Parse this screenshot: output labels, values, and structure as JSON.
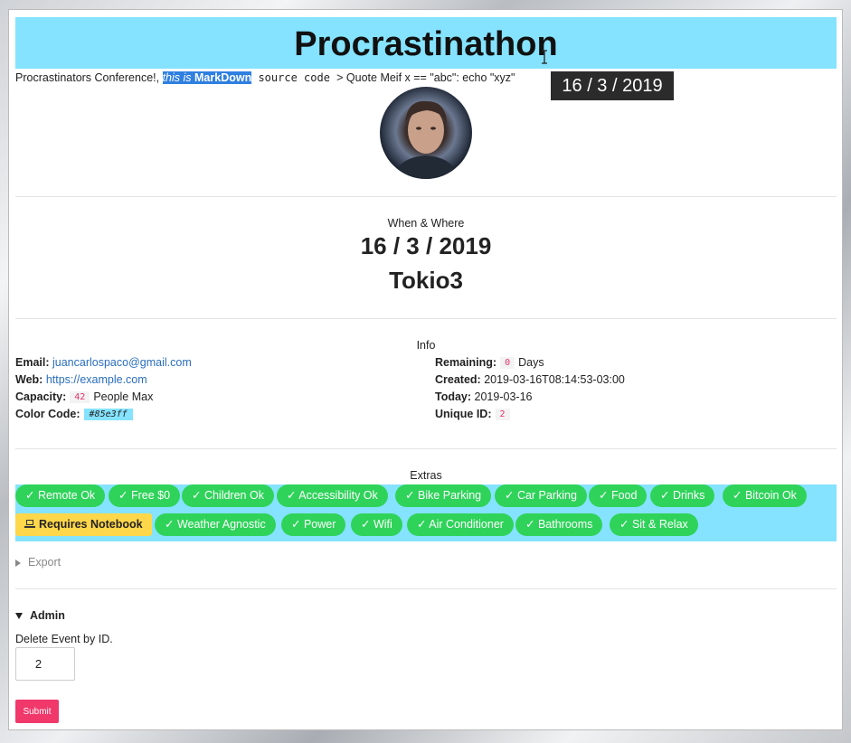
{
  "header": {
    "title": "Procrastinathon"
  },
  "description": {
    "prefix": "Procrastinators Conference!, ",
    "em_text": "this is ",
    "strong_text": "MarkDown",
    "code_text": " source code ",
    "suffix": "> Quote Meif x == \"abc\": echo \"xyz\""
  },
  "tooltip": {
    "text": "16 / 3 / 2019"
  },
  "when_where": {
    "label": "When & Where",
    "date": "16 / 3 / 2019",
    "place": "Tokio3"
  },
  "info": {
    "label": "Info",
    "email_label": "Email:",
    "email": "juancarlospaco@gmail.com",
    "web_label": "Web:",
    "web": "https://example.com",
    "capacity_label": "Capacity:",
    "capacity": "42",
    "capacity_suffix": "People Max",
    "color_label": "Color Code:",
    "color": "#85e3ff",
    "remaining_label": "Remaining:",
    "remaining": "0",
    "remaining_suffix": "Days",
    "created_label": "Created:",
    "created": "2019-03-16T08:14:53-03:00",
    "today_label": "Today:",
    "today": "2019-03-16",
    "uid_label": "Unique ID:",
    "uid": "2"
  },
  "extras": {
    "label": "Extras",
    "chips_row1": [
      "✓ Remote Ok",
      "✓ Free $0",
      "✓ Children Ok",
      "✓ Accessibility Ok",
      "✓ Bike Parking",
      "✓ Car Parking",
      "✓ Food",
      "✓ Drinks",
      "✓ Bitcoin Ok"
    ],
    "notebook": "Requires Notebook",
    "chips_row2": [
      "✓ Weather Agnostic",
      "✓ Power",
      "✓ Wifi",
      "✓ Air Conditioner",
      "✓ Bathrooms",
      "✓ Sit & Relax"
    ]
  },
  "export": {
    "label": "Export"
  },
  "admin": {
    "label": "Admin",
    "delete_label": "Delete Event by ID.",
    "id_value": "2",
    "submit_label": "Submit"
  },
  "colors": {
    "accent": "#85e3ff",
    "chip": "#2fd35a",
    "warn": "#ffd74a",
    "submit": "#f0386b",
    "badge_text": "#e8336b"
  },
  "icons": {
    "notebook": "laptop-icon",
    "export": "triangle-right-icon",
    "admin": "triangle-down-icon"
  }
}
